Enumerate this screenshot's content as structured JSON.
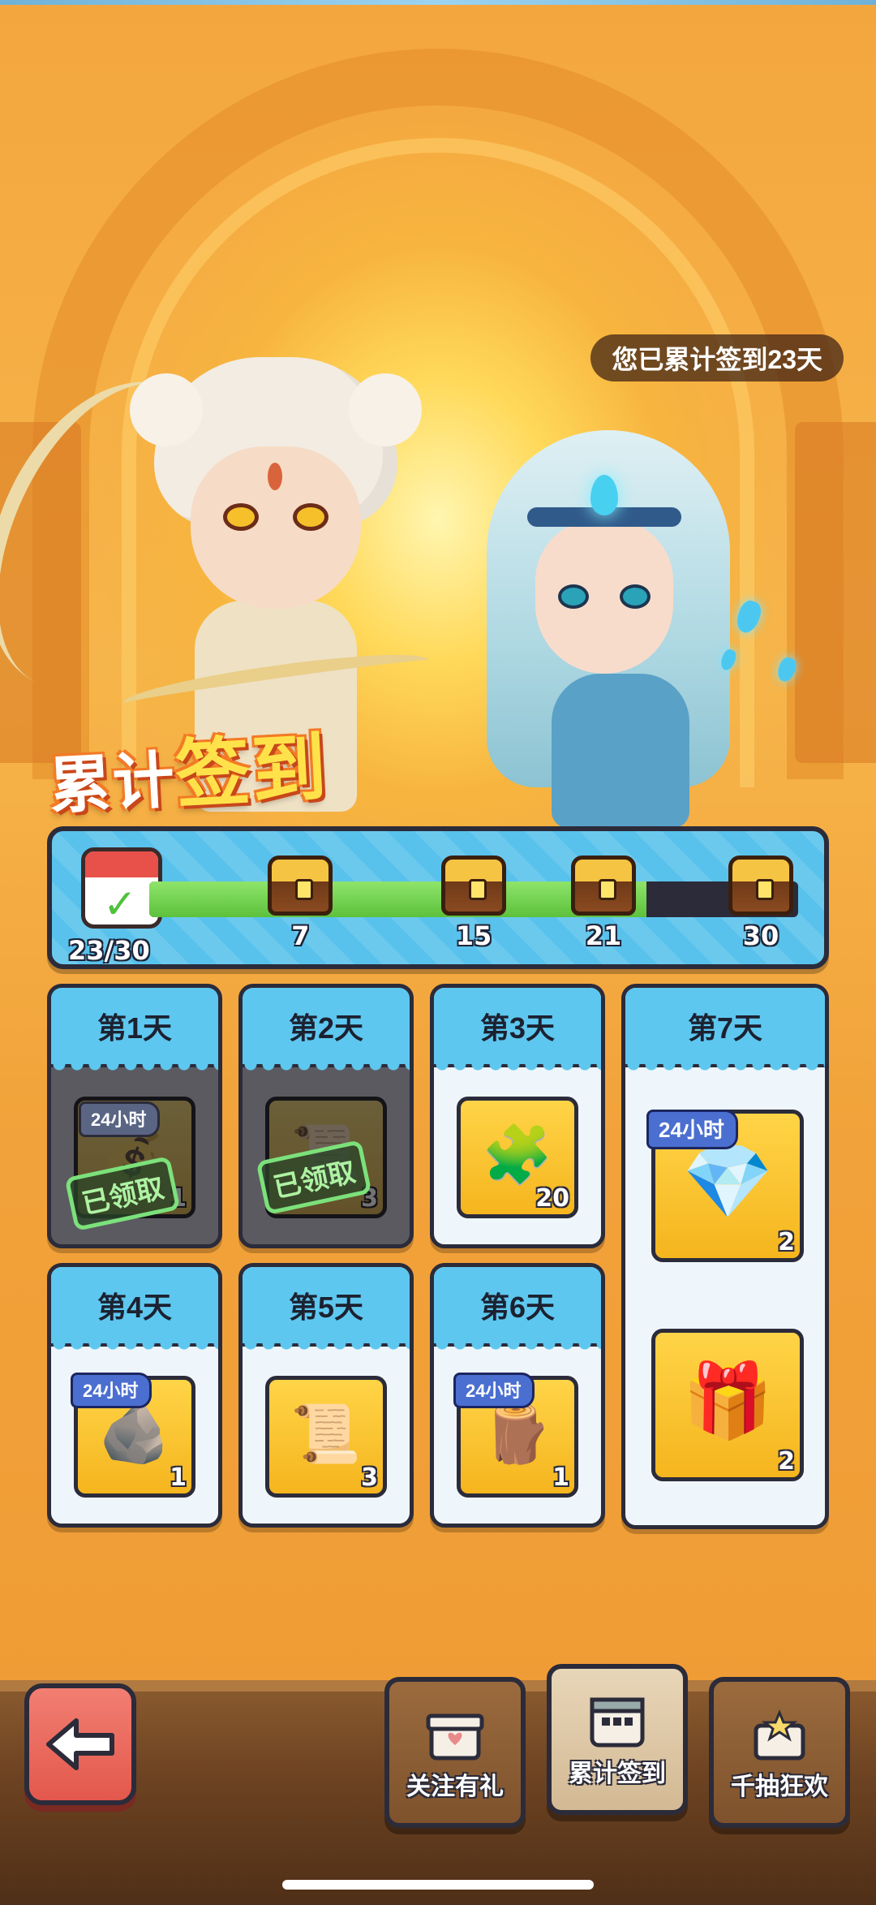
{
  "counter_badge": "您已累计签到23天",
  "title": {
    "part1": "累计",
    "part2": "签到"
  },
  "progress": {
    "count": "23/30",
    "fraction": 0.7667,
    "milestones": [
      {
        "label": "7",
        "pos": 0.233
      },
      {
        "label": "15",
        "pos": 0.5
      },
      {
        "label": "21",
        "pos": 0.7
      },
      {
        "label": "30",
        "pos": 1.0
      }
    ]
  },
  "days": [
    {
      "title": "第1天",
      "timer": "24小时",
      "claimed_text": "已领取",
      "qty": "1",
      "icon": "coin-pile-icon",
      "status": "claimed"
    },
    {
      "title": "第2天",
      "claimed_text": "已领取",
      "qty": "3",
      "icon": "scroll-icon",
      "status": "claimed"
    },
    {
      "title": "第3天",
      "qty": "20",
      "icon": "puzzle-armor-icon",
      "status": "available"
    },
    {
      "title": "第4天",
      "timer": "24小时",
      "qty": "1",
      "icon": "ore-sack-icon",
      "status": "available"
    },
    {
      "title": "第5天",
      "qty": "3",
      "icon": "scroll-icon",
      "status": "available"
    },
    {
      "title": "第6天",
      "timer": "24小时",
      "qty": "1",
      "icon": "wood-logs-icon",
      "status": "available"
    },
    {
      "title": "第7天",
      "timer": "24小时",
      "qty_a": "2",
      "qty_b": "2",
      "icon_a": "gem-chest-icon",
      "icon_b": "hero-chest-icon",
      "status": "available"
    }
  ],
  "nav": {
    "back_icon": "back-arrow-icon",
    "tabs": [
      {
        "label": "关注有礼",
        "icon": "gift-icon"
      },
      {
        "label": "累计签到",
        "icon": "calendar-icon",
        "active": true
      },
      {
        "label": "千抽狂欢",
        "icon": "star-gift-icon"
      }
    ]
  },
  "colors": {
    "accent": "#5ec7ef",
    "progress_fill": "#5dc13c",
    "back_button": "#e3584c"
  }
}
